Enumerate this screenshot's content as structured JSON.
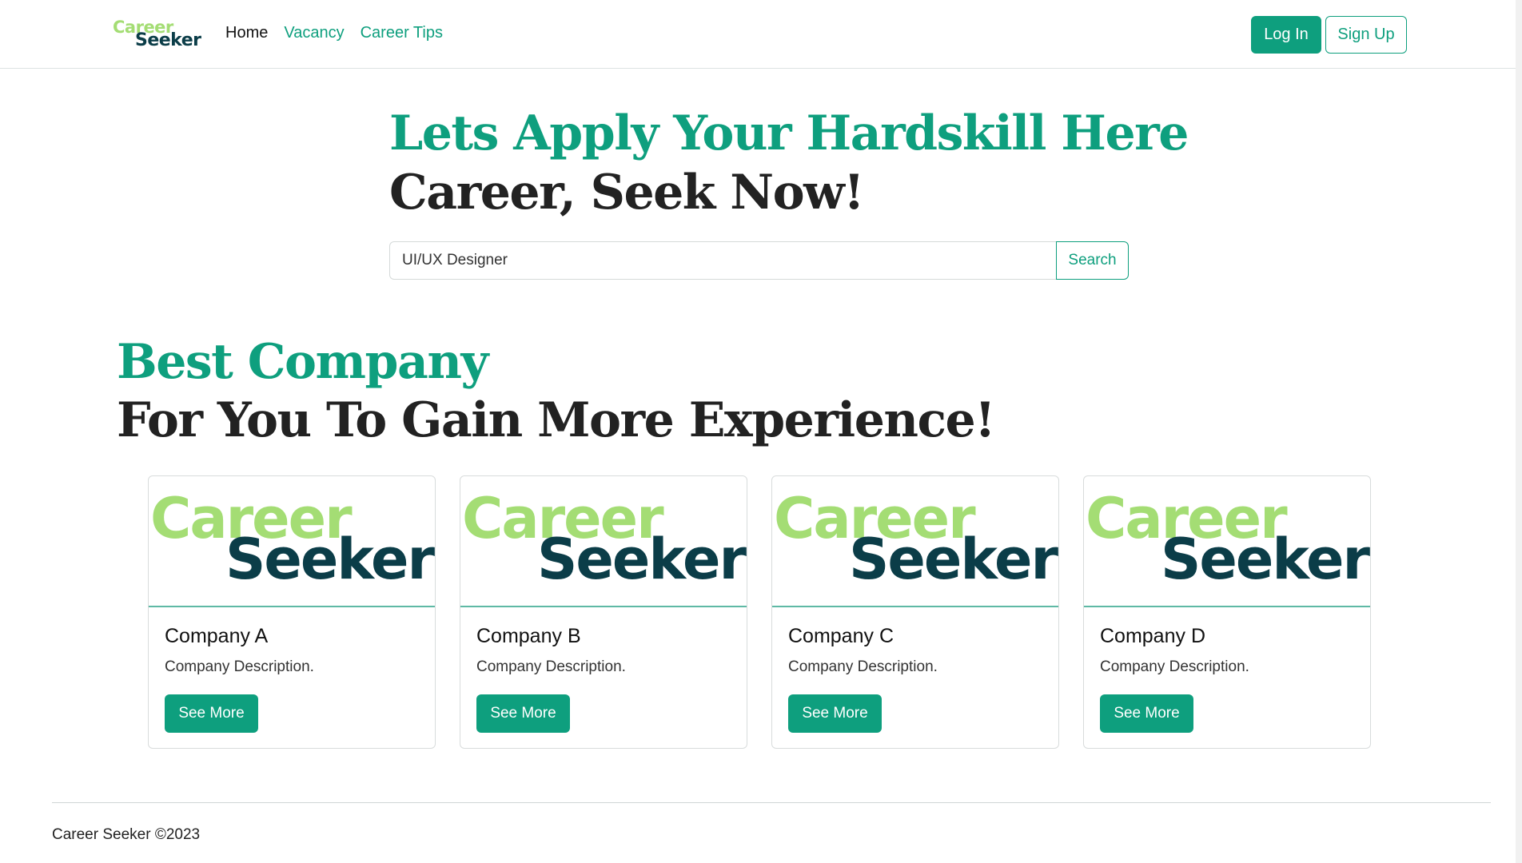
{
  "brand": {
    "logo_line1": "Career",
    "logo_line2": "Seeker"
  },
  "nav": {
    "links": [
      "Home",
      "Vacancy",
      "Career Tips"
    ],
    "active": "Home",
    "login_label": "Log In",
    "signup_label": "Sign Up"
  },
  "hero": {
    "title_line1": "Lets Apply Your Hardskill Here",
    "title_line2": "Career, Seek Now!",
    "search_value": "UI/UX Designer",
    "search_button": "Search"
  },
  "section": {
    "title_line1": "Best Company",
    "title_line2": "For You To Gain More Experience!"
  },
  "cards": [
    {
      "logo_line1": "Career",
      "logo_line2": "Seeker",
      "title": "Company A",
      "description": "Company Description.",
      "button": "See More"
    },
    {
      "logo_line1": "Career",
      "logo_line2": "Seeker",
      "title": "Company B",
      "description": "Company Description.",
      "button": "See More"
    },
    {
      "logo_line1": "Career",
      "logo_line2": "Seeker",
      "title": "Company C",
      "description": "Company Description.",
      "button": "See More"
    },
    {
      "logo_line1": "Career",
      "logo_line2": "Seeker",
      "title": "Company D",
      "description": "Company Description.",
      "button": "See More"
    }
  ],
  "footer": {
    "text": "Career Seeker ©2023"
  },
  "colors": {
    "accent": "#0e9f7e",
    "logo_light": "#a4dd74",
    "logo_dark": "#0b3d48"
  }
}
